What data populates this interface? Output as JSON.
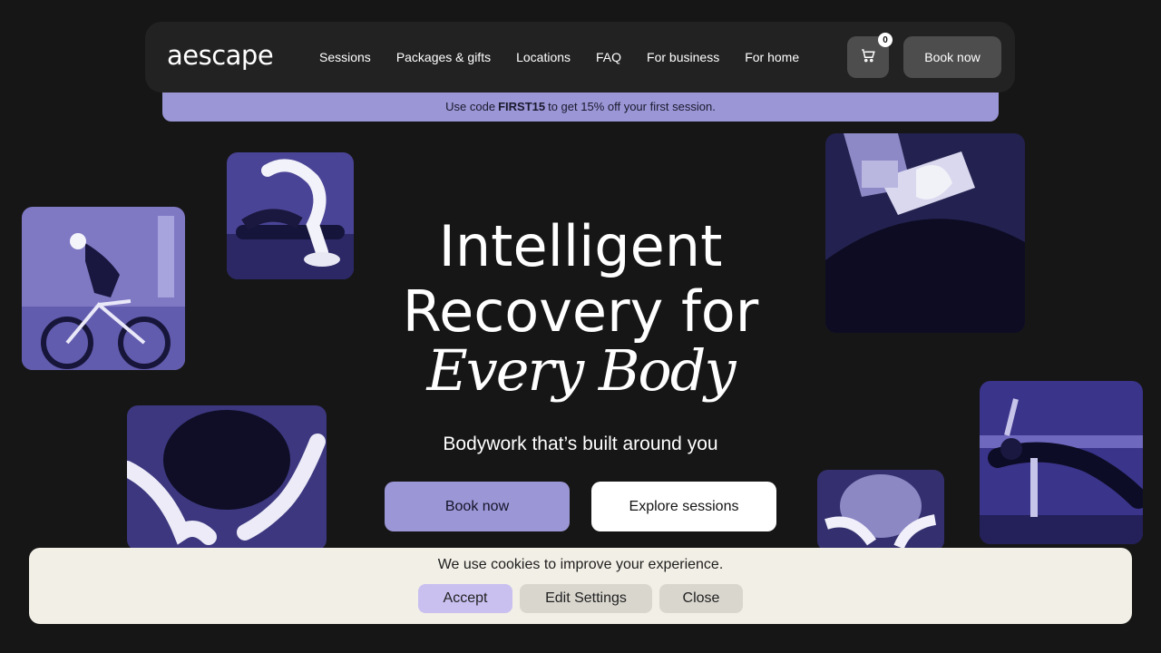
{
  "header": {
    "logo": "aescape",
    "nav": [
      "Sessions",
      "Packages & gifts",
      "Locations",
      "FAQ",
      "For business",
      "For home"
    ],
    "cart_count": "0",
    "book_label": "Book now"
  },
  "promo": {
    "prefix": "Use code",
    "code": "FIRST15",
    "suffix": "to get 15% off your first session."
  },
  "hero": {
    "title_line1": "Intelligent",
    "title_line2": "Recovery for",
    "title_italic": "Every Body",
    "subtitle": "Bodywork that’s built around you",
    "primary_cta": "Book now",
    "secondary_cta": "Explore sessions"
  },
  "cookie": {
    "message": "We use cookies to improve your experience.",
    "accept": "Accept",
    "edit": "Edit Settings",
    "close": "Close"
  },
  "colors": {
    "background": "#161616",
    "navbar": "#222222",
    "accent": "#9b96d6",
    "cookie_bg": "#f2efe6"
  }
}
